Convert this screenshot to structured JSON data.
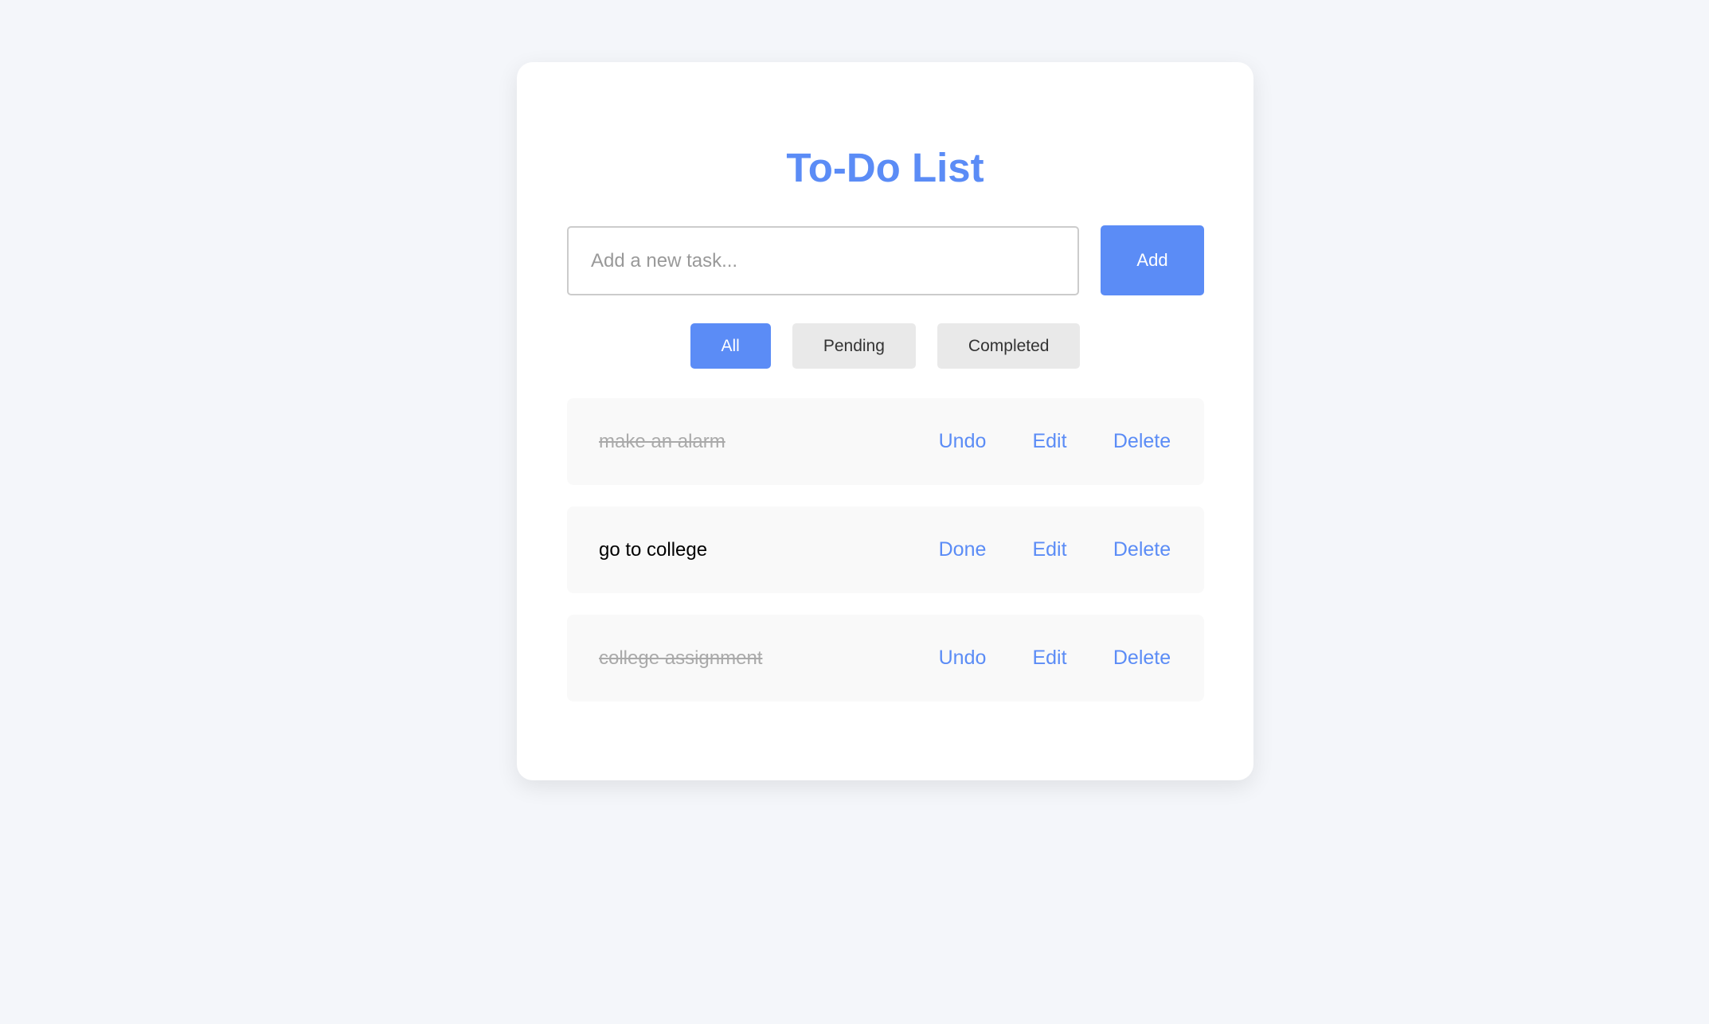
{
  "colors": {
    "accent": "#5b8cf6",
    "page_background": "#f4f6fa",
    "card_background": "#ffffff",
    "item_background": "#f9f9f9",
    "completed_text": "#aaaaaa",
    "filter_inactive": "#e9e9e9"
  },
  "app": {
    "title": "To-Do List"
  },
  "new_task": {
    "value": "",
    "placeholder": "Add a new task...",
    "add_label": "Add"
  },
  "filters": {
    "all": "All",
    "pending": "Pending",
    "completed": "Completed",
    "active": "All"
  },
  "tasks": [
    {
      "text": "make an alarm",
      "completed": true,
      "toggle_label": "Undo",
      "edit_label": "Edit",
      "delete_label": "Delete"
    },
    {
      "text": "go to college",
      "completed": false,
      "toggle_label": "Done",
      "edit_label": "Edit",
      "delete_label": "Delete"
    },
    {
      "text": "college assignment",
      "completed": true,
      "toggle_label": "Undo",
      "edit_label": "Edit",
      "delete_label": "Delete"
    }
  ]
}
